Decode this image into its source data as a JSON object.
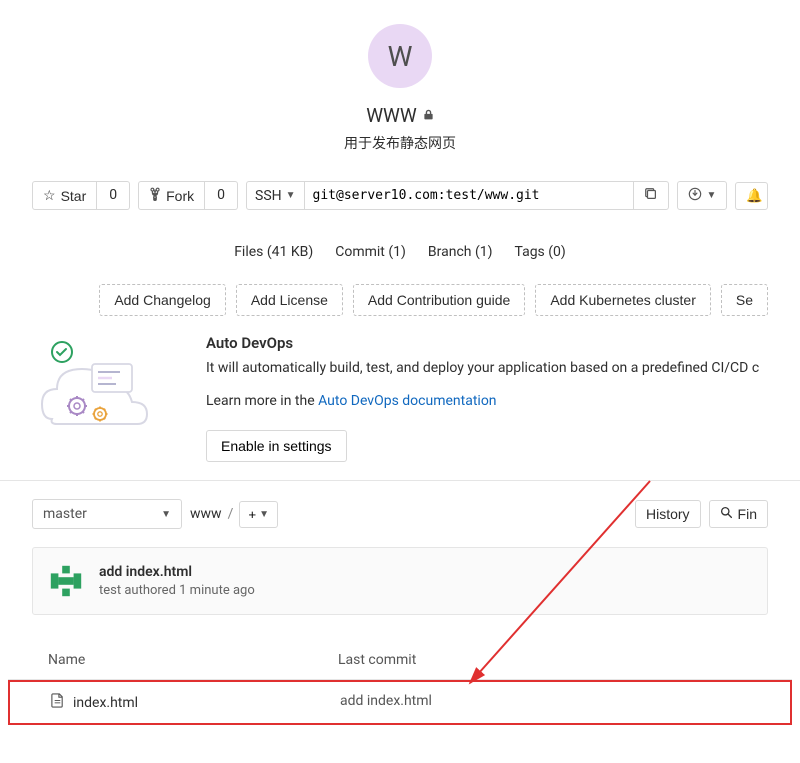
{
  "project": {
    "avatar_letter": "W",
    "name": "WWW",
    "description": "用于发布静态网页"
  },
  "toolbar": {
    "star_label": "Star",
    "star_count": "0",
    "fork_label": "Fork",
    "fork_count": "0",
    "protocol": "SSH",
    "clone_url": "git@server10.com:test/www.git"
  },
  "stats": {
    "files": "Files (41 KB)",
    "commits": "Commit (1)",
    "branches": "Branch (1)",
    "tags": "Tags (0)"
  },
  "suggestions": {
    "changelog": "Add Changelog",
    "license": "Add License",
    "contribution": "Add Contribution guide",
    "kubernetes": "Add Kubernetes cluster",
    "setup_partial": "Se"
  },
  "devops": {
    "title": "Auto DevOps",
    "description": "It will automatically build, test, and deploy your application based on a predefined CI/CD c",
    "learn_prefix": "Learn more in the ",
    "learn_link": "Auto DevOps documentation",
    "enable_btn": "Enable in settings"
  },
  "tree": {
    "branch": "master",
    "root": "www",
    "history_btn": "History",
    "find_partial": "Fin"
  },
  "last_commit": {
    "message": "add index.html",
    "meta": "test authored 1 minute ago"
  },
  "columns": {
    "name": "Name",
    "last_commit": "Last commit"
  },
  "files": [
    {
      "name": "index.html",
      "commit": "add index.html"
    }
  ]
}
